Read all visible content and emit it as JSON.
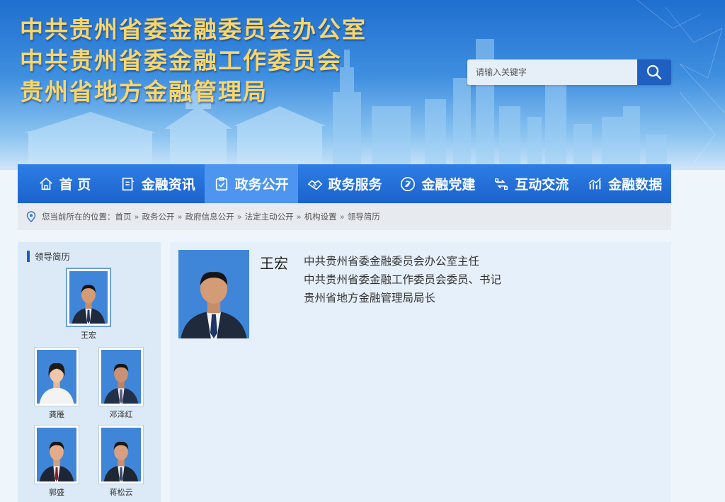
{
  "header": {
    "titles": [
      "中共贵州省委金融委员会办公室",
      "中共贵州省委金融工作委员会",
      "贵州省地方金融管理局"
    ],
    "search_placeholder": "请输入关键字",
    "search_icon": "search-icon"
  },
  "nav": {
    "items": [
      {
        "label": "首 页",
        "icon": "home-icon",
        "active": false
      },
      {
        "label": "金融资讯",
        "icon": "document-icon",
        "active": false
      },
      {
        "label": "政务公开",
        "icon": "checklist-icon",
        "active": true
      },
      {
        "label": "政务服务",
        "icon": "handshake-icon",
        "active": false
      },
      {
        "label": "金融党建",
        "icon": "party-emblem-icon",
        "active": false
      },
      {
        "label": "互动交流",
        "icon": "exchange-icon",
        "active": false
      },
      {
        "label": "金融数据",
        "icon": "chart-icon",
        "active": false
      }
    ]
  },
  "breadcrumb": {
    "prefix": "您当前所在的位置：",
    "items": [
      "首页",
      "政务公开",
      "政府信息公开",
      "法定主动公开",
      "机构设置",
      "领导简历"
    ],
    "separator": "»"
  },
  "sidebar": {
    "title": "领导简历",
    "leaders": [
      {
        "name": "王宏",
        "selected": true
      },
      {
        "name": "龚雁",
        "selected": false
      },
      {
        "name": "邓泽红",
        "selected": false
      },
      {
        "name": "郭盛",
        "selected": false
      },
      {
        "name": "蒋松云",
        "selected": false
      }
    ]
  },
  "detail": {
    "name": "王宏",
    "positions": [
      "中共贵州省委金融委员会办公室主任",
      "中共贵州省委金融工作委员会委员、书记",
      "贵州省地方金融管理局局长"
    ]
  },
  "colors": {
    "nav_bg": "#1f66d1",
    "nav_active": "#4d95ee",
    "title_gold": "#f8d66a",
    "panel_bg": "#dceaf7"
  }
}
